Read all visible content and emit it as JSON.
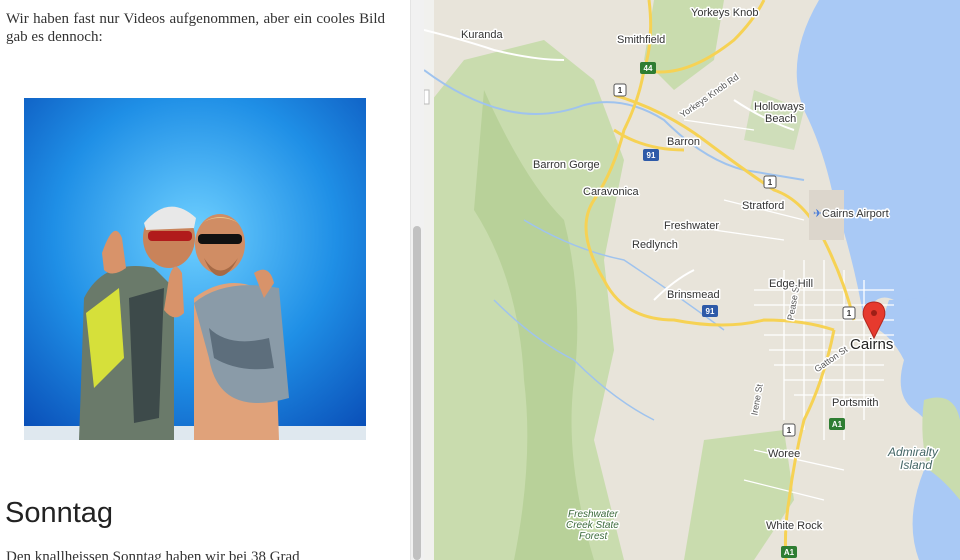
{
  "article": {
    "intro_text": "Wir haben fast nur Videos aufgenommen, aber ein cooles Bild gab es dennoch:",
    "section_heading": "Sonntag",
    "following_text": "Den knallheissen Sonntag haben wir bei 38 Grad"
  },
  "map": {
    "places": {
      "yorkeys_knob": "Yorkeys Knob",
      "kuranda": "Kuranda",
      "smithfield": "Smithfield",
      "holloways_beach_1": "Holloways",
      "holloways_beach_2": "Beach",
      "barron": "Barron",
      "barron_gorge": "Barron Gorge",
      "caravonica": "Caravonica",
      "stratford": "Stratford",
      "cairns_airport": "Cairns Airport",
      "freshwater": "Freshwater",
      "redlynch": "Redlynch",
      "edge_hill": "Edge Hill",
      "brinsmead": "Brinsmead",
      "cairns": "Cairns",
      "portsmith": "Portsmith",
      "admiralty_island_1": "Admiralty",
      "admiralty_island_2": "Island",
      "woree": "Woree",
      "white_rock": "White Rock",
      "freshwater_creek_1": "Freshwater",
      "freshwater_creek_2": "Creek State",
      "freshwater_creek_3": "Forest"
    },
    "streets": {
      "yorkeys_knob_rd": "Yorkeys Knob Rd",
      "pease_st": "Pease St",
      "gatton_st": "Gatton St",
      "irene_st": "Irene St"
    },
    "route_shields": {
      "r44": "44",
      "r1_top": "1",
      "r91_top": "91",
      "r1_mid": "1",
      "r91_bottom": "91",
      "r1_cairns": "1",
      "r1_south": "1",
      "a1_upper": "A1",
      "a1_lower": "A1"
    },
    "colors": {
      "land": "#e8e4da",
      "park": "#c9dcae",
      "water": "#a9c9f5",
      "major_road": "#f6d254",
      "marker": "#e63a2e"
    }
  }
}
